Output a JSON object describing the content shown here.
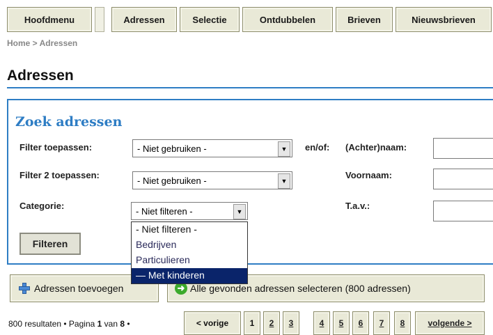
{
  "nav": {
    "items": [
      "Hoofdmenu",
      "Adressen",
      "Selectie",
      "Ontdubbelen",
      "Brieven",
      "Nieuwsbrieven"
    ]
  },
  "breadcrumb": "Home > Adressen",
  "page_title": "Adressen",
  "search": {
    "title": "Zoek adressen",
    "filter1_label": "Filter toepassen:",
    "filter1_value": "- Niet gebruiken -",
    "andor_label": "en/of:",
    "lastname_label": "(Achter)naam:",
    "filter2_label": "Filter 2 toepassen:",
    "filter2_value": "- Niet gebruiken -",
    "firstname_label": "Voornaam:",
    "category_label": "Categorie:",
    "category_value": "- Niet filteren -",
    "tav_label": "T.a.v.:",
    "filter_button": "Filteren",
    "category_options": [
      "- Niet filteren -",
      "Bedrijven",
      "Particulieren",
      "— Met kinderen"
    ],
    "highlighted_option": "— Met kinderen"
  },
  "actions": {
    "add_label": "Adressen toevoegen",
    "select_all_label": "Alle gevonden adressen selecteren (800 adressen)"
  },
  "pager": {
    "results_text": "800 resultaten • Pagina ",
    "current_page": "1",
    "of_text": " van ",
    "total_pages": "8",
    "tail_text": " •",
    "prev_label": "< vorige",
    "pages": [
      "1",
      "2",
      "3",
      "4",
      "5",
      "6",
      "7",
      "8"
    ],
    "next_label": "volgende >"
  },
  "icons": {
    "add": "plus-icon",
    "go": "arrow-right-icon",
    "dropdown": "chevron-down-icon"
  },
  "colors": {
    "accent": "#2e7dc4",
    "button_bg": "#e9e9d7",
    "highlight": "#0a246a"
  }
}
